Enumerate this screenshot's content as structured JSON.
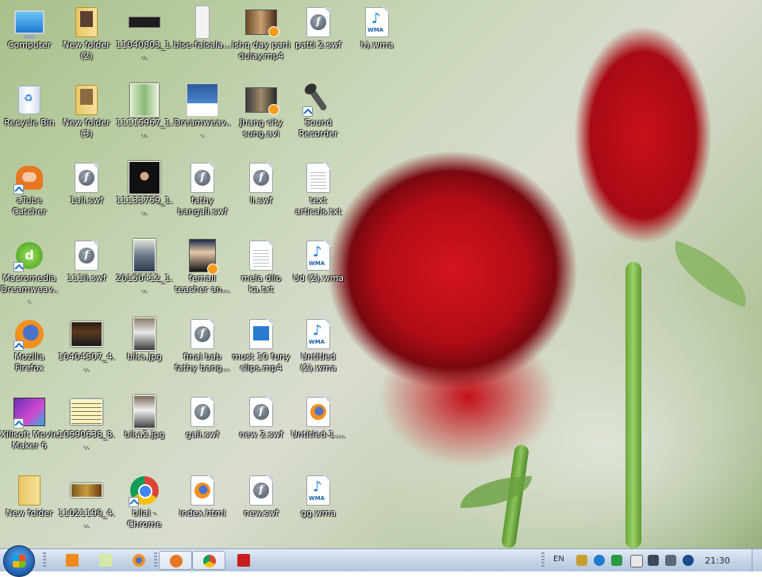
{
  "desktop": {
    "icons": [
      {
        "label": "Computer"
      },
      {
        "label": "New folder (2)"
      },
      {
        "label": "11040803_1..."
      },
      {
        "label": "bise-faisala..."
      },
      {
        "label": "ishq day pani dulay.mp4"
      },
      {
        "label": "patti 2.swf"
      },
      {
        "label": "h).wma"
      },
      {
        "label": "Recycle Bin"
      },
      {
        "label": "New folder (3)"
      },
      {
        "label": "11115967_1..."
      },
      {
        "label": "Dreamweav..."
      },
      {
        "label": "Jhang city sung.avi"
      },
      {
        "label": "Sound Recorder"
      },
      {
        "label": "aTube Catcher"
      },
      {
        "label": "1ali.swf"
      },
      {
        "label": "11133759_1..."
      },
      {
        "label": "fathy bangali.swf"
      },
      {
        "label": "li.swf"
      },
      {
        "label": "text articals.txt"
      },
      {
        "label": "Macromedia Dreamweav..."
      },
      {
        "label": "111li.swf"
      },
      {
        "label": "20150412_1..."
      },
      {
        "label": "femail teacher an..."
      },
      {
        "label": "mela dilo ka.txt"
      },
      {
        "label": "Ud (2).wma"
      },
      {
        "label": "Mozilla Firefox"
      },
      {
        "label": "10404507_4..."
      },
      {
        "label": "bil;a.jpg"
      },
      {
        "label": "final bab fathy bang..."
      },
      {
        "label": "must 10 funy clips.mp4"
      },
      {
        "label": "Untitled (2).wma"
      },
      {
        "label": "Xilisoft Movie Maker 6"
      },
      {
        "label": "10590638_8..."
      },
      {
        "label": "bil;a2.jpg"
      },
      {
        "label": "gali.swf"
      },
      {
        "label": "new 2.swf"
      },
      {
        "label": "Untitled-1...."
      },
      {
        "label": "New folder"
      },
      {
        "label": "11021199_4..."
      },
      {
        "label": "bilal - Chrome"
      },
      {
        "label": "index.html"
      },
      {
        "label": "new.swf"
      },
      {
        "label": "gg.wma"
      }
    ],
    "wma_tag": "WMA",
    "swf_letter": "f",
    "dw_letter": "d"
  },
  "taskbar": {
    "language": "EN",
    "clock": "21:30"
  }
}
